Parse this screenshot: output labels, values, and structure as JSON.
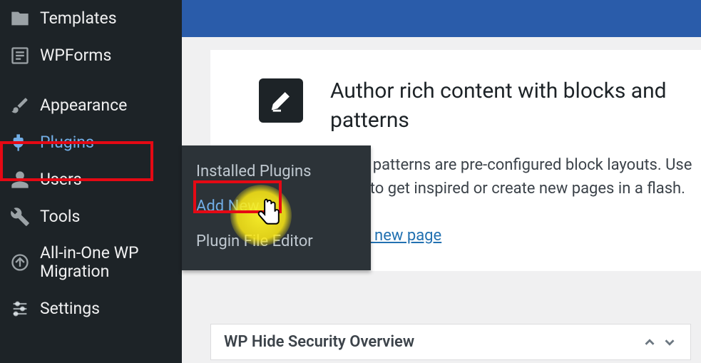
{
  "sidebar": {
    "items": [
      {
        "label": "Templates"
      },
      {
        "label": "WPForms"
      },
      {
        "label": "Appearance"
      },
      {
        "label": "Plugins"
      },
      {
        "label": "Users"
      },
      {
        "label": "Tools"
      },
      {
        "label": "All-in-One WP Migration"
      },
      {
        "label": "Settings"
      }
    ]
  },
  "submenu": {
    "items": [
      {
        "label": "Installed Plugins"
      },
      {
        "label": "Add New"
      },
      {
        "label": "Plugin File Editor"
      }
    ]
  },
  "patterns": {
    "title": "Author rich content with blocks and patterns",
    "body_line1": "Block patterns are pre-configured block layouts. Use them to get inspired or create new pages in a flash.",
    "link": "Add a new page"
  },
  "overview": {
    "title": "WP Hide Security Overview"
  }
}
